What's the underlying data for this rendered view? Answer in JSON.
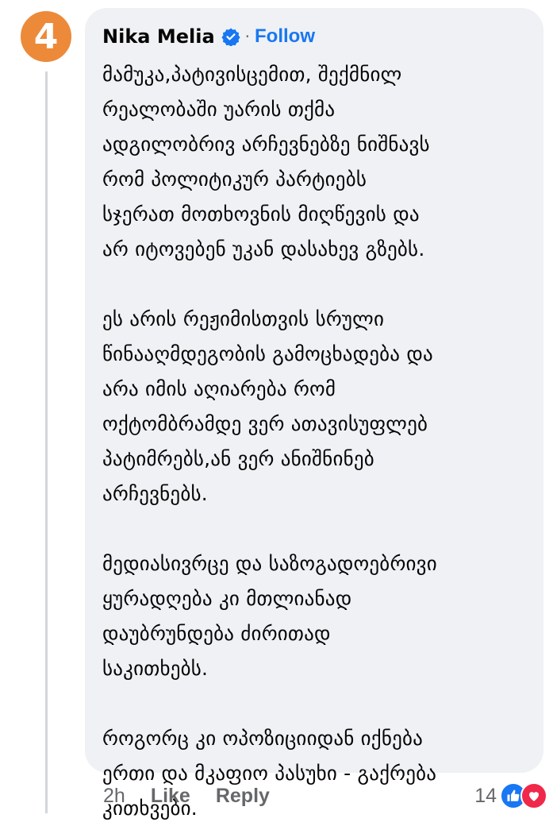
{
  "comment": {
    "rank_badge": "4",
    "author": "Nika Melia",
    "follow_label": "Follow",
    "separator": "·",
    "paragraphs": [
      "მამუკა,პატივისცემით, შექმნილ\nრეალობაში უარის თქმა\nადგილობრივ არჩევნებზე ნიშნავს\nრომ პოლიტიკურ პარტიებს\nსჯერათ მოთხოვნის მიღწევის და\nარ იტოვებენ უკან დასახევ გზებს.",
      "ეს არის რეჟიმისთვის სრული\nწინააღმდეგობის გამოცხადება და\nარა იმის აღიარება რომ\nოქტომბრამდე ვერ ათავისუფლებ\nპატიმრებს,ან ვერ ანიშნინებ\nარჩევნებს.",
      "მედიასივრცე და საზოგადოებრივი\nყურადღება კი მთლიანად\nდაუბრუნდება ძირითად\nსაკითხებს.",
      "როგორც კი ოპოზიციიდან იქნება\nერთი და მკაფიო პასუხი - გაქრება\nკითხვები."
    ]
  },
  "footer": {
    "time": "2h",
    "like_label": "Like",
    "reply_label": "Reply",
    "reaction_count": "14",
    "reactions": [
      "like-icon",
      "heart-icon"
    ]
  },
  "colors": {
    "badge": "#ec8a3a",
    "link": "#1877f2",
    "bubble": "#eff1f4",
    "love": "#f0284a"
  }
}
